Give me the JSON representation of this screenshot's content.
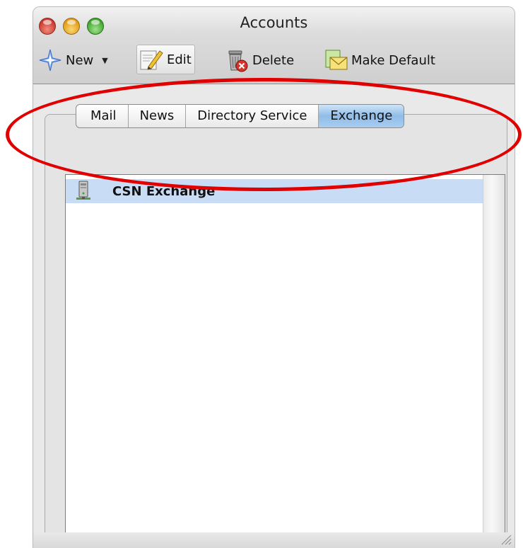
{
  "window": {
    "title": "Accounts"
  },
  "toolbar": {
    "new_label": "New",
    "edit_label": "Edit",
    "delete_label": "Delete",
    "make_default_label": "Make Default"
  },
  "tabs": [
    {
      "label": "Mail",
      "active": false
    },
    {
      "label": "News",
      "active": false
    },
    {
      "label": "Directory Service",
      "active": false
    },
    {
      "label": "Exchange",
      "active": true
    }
  ],
  "accounts": [
    {
      "name": "CSN Exchange",
      "icon": "server-icon",
      "selected": true
    }
  ],
  "colors": {
    "annotation": "#e10000",
    "selection": "#c8dcf5",
    "active_tab": "#8fbce8"
  }
}
